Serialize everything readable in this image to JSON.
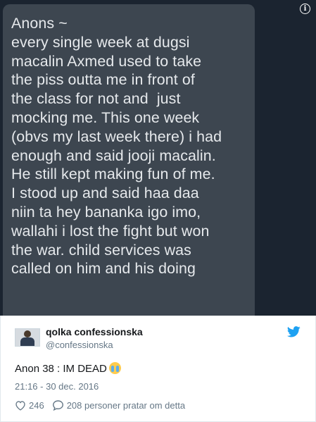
{
  "media": {
    "confession_text": "Anons ~\nevery single week at dugsi\nmacalin Axmed used to take\nthe piss outta me in front of\nthe class for not and  just\nmocking me. This one week\n(obvs my last week there) i had\nenough and said jooji macalin.\nHe still kept making fun of me.\nI stood up and said haa daa\nniin ta hey bananka igo imo,\nwallahi i lost the fight but won\nthe war. child services was\ncalled on him and his doing",
    "info_icon_glyph": "i"
  },
  "tweet": {
    "display_name": "qolka confessionska",
    "handle": "@confessionska",
    "text": "Anon 38 : IM DEAD",
    "emoji": "loudly-crying-face",
    "timestamp": "21:16 - 30 dec. 2016",
    "likes": "246",
    "replies_text": "208 personer pratar om detta"
  },
  "colors": {
    "media_bg": "#1b2430",
    "bubble_bg": "#3d4650",
    "twitter_blue": "#1da1f2",
    "secondary_text": "#657786"
  }
}
